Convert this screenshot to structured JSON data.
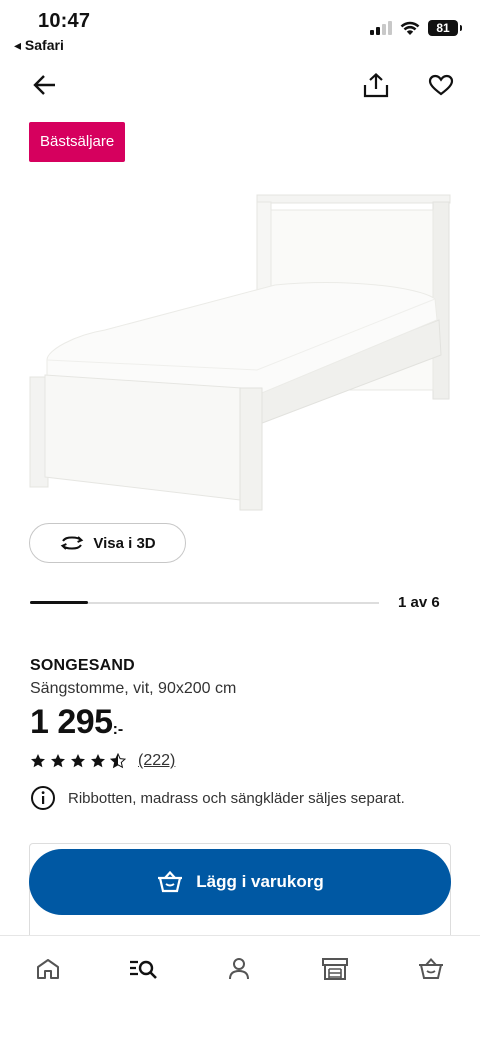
{
  "status_bar": {
    "time": "10:47",
    "back_app": "◂ Safari",
    "battery": "81"
  },
  "nav": {
    "back_icon": "arrow-left-icon",
    "share_icon": "share-icon",
    "favorite_icon": "heart-icon"
  },
  "badge": {
    "label": "Bästsäljare",
    "color": "#d6005e"
  },
  "view3d": {
    "label": "Visa i 3D"
  },
  "gallery": {
    "counter": "1 av 6",
    "current": 1,
    "total": 6
  },
  "product": {
    "name": "SONGESAND",
    "description": "Sängstomme, vit, 90x200 cm",
    "price": "1 295",
    "price_suffix": ":-",
    "rating": 4.5,
    "review_count": "(222)",
    "info": "Ribbotten, madrass och sängkläder säljes separat."
  },
  "cart_button": {
    "label": "Lägg i varukorg",
    "color": "#0058a3"
  },
  "tabbar": {
    "items": [
      {
        "name": "home",
        "icon": "home-icon"
      },
      {
        "name": "search",
        "icon": "search-icon"
      },
      {
        "name": "profile",
        "icon": "person-icon"
      },
      {
        "name": "store",
        "icon": "store-icon"
      },
      {
        "name": "cart",
        "icon": "cart-icon"
      }
    ]
  }
}
